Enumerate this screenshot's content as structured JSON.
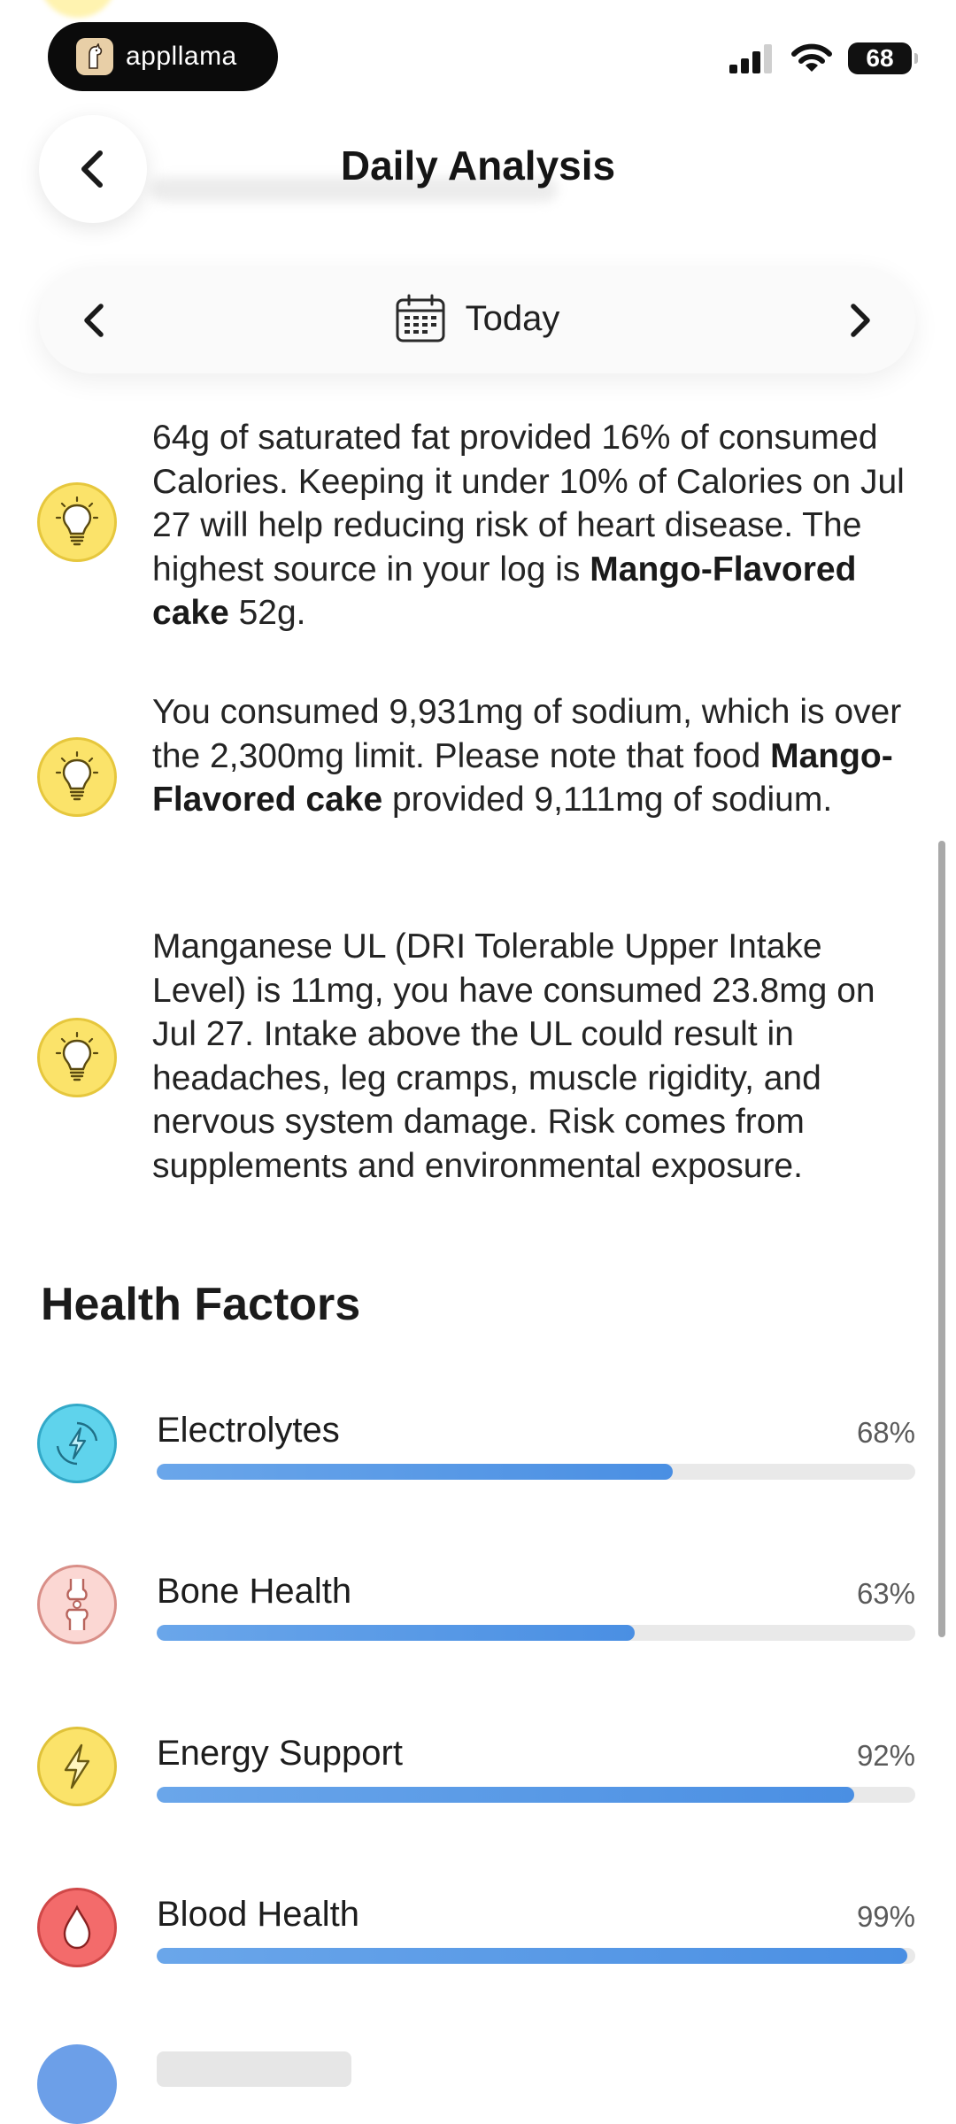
{
  "status_bar": {
    "app_name": "appllama",
    "battery": "68"
  },
  "header": {
    "title": "Daily Analysis"
  },
  "date_nav": {
    "label": "Today"
  },
  "insights": [
    {
      "icon": "lightbulb-icon",
      "parts": [
        {
          "text": "64g of saturated fat provided 16% of consumed Calories. Keeping it under 10% of Calories on Jul 27 will help reducing risk of heart disease. The highest source in your log is ",
          "bold": false
        },
        {
          "text": "Mango-Flavored cake",
          "bold": true
        },
        {
          "text": " 52g.",
          "bold": false
        }
      ]
    },
    {
      "icon": "lightbulb-icon",
      "parts": [
        {
          "text": "You consumed 9,931mg of sodium, which is over the 2,300mg limit. Please note that food ",
          "bold": false
        },
        {
          "text": "Mango-Flavored cake",
          "bold": true
        },
        {
          "text": " provided 9,111mg of sodium.",
          "bold": false
        }
      ]
    },
    {
      "icon": "lightbulb-icon",
      "parts": [
        {
          "text": "Manganese UL (DRI Tolerable Upper Intake Level) is 11mg, you have consumed 23.8mg on Jul 27. Intake above the UL could result in headaches, leg cramps, muscle rigidity, and nervous system damage. Risk comes from supplements and environmental exposure.",
          "bold": false
        }
      ]
    }
  ],
  "health_factors": {
    "title": "Health Factors",
    "items": [
      {
        "name": "Electrolytes",
        "percent_label": "68%",
        "value": 0.68,
        "icon": "lightning-cycle-icon",
        "color": "#5fd3ec"
      },
      {
        "name": "Bone Health",
        "percent_label": "63%",
        "value": 0.63,
        "icon": "bone-joint-icon",
        "color": "#fbd7d3"
      },
      {
        "name": "Energy Support",
        "percent_label": "92%",
        "value": 0.92,
        "icon": "lightning-bolt-icon",
        "color": "#fbe36a"
      },
      {
        "name": "Blood Health",
        "percent_label": "99%",
        "value": 0.99,
        "icon": "blood-drop-icon",
        "color": "#f36b6b"
      }
    ]
  },
  "colors": {
    "accent_bar": "#4a8fe3",
    "track": "#e9e9e9",
    "bulb": "#fbe36a"
  }
}
